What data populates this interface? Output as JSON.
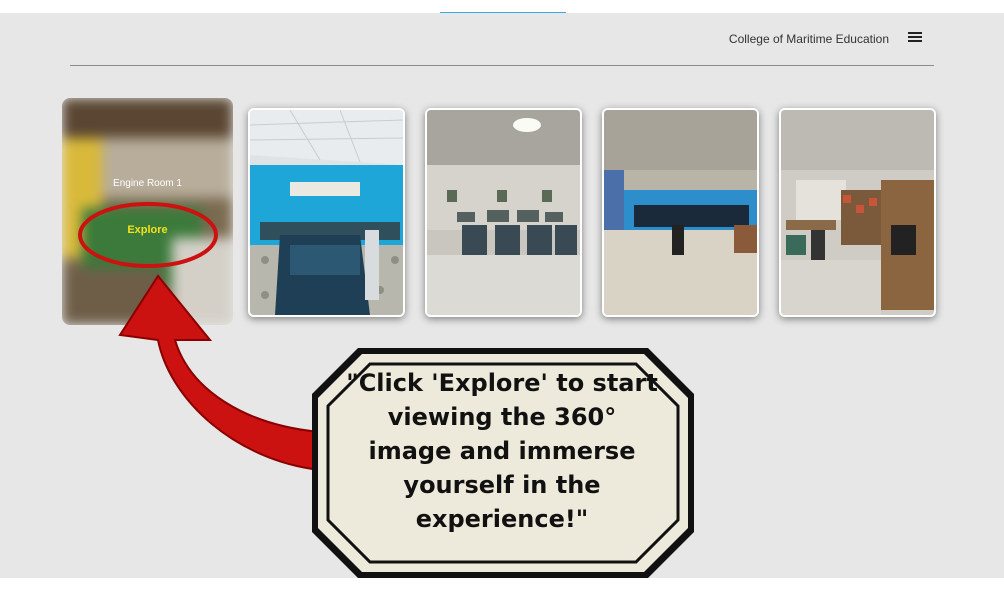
{
  "header": {
    "brand": "College of Maritime Education",
    "menu_icon": "hamburger-icon"
  },
  "featured": {
    "title": "Engine Room 1",
    "explore_label": "Explore"
  },
  "gallery": [
    {
      "name": "engine-room-console"
    },
    {
      "name": "control-room-desks"
    },
    {
      "name": "bridge-simulator"
    },
    {
      "name": "workshop-room"
    }
  ],
  "callout": {
    "lines": [
      "\"Click 'Explore' to start",
      "viewing the 360°",
      "image and immerse",
      "yourself in the",
      "experience!\""
    ]
  },
  "colors": {
    "panel_bg": "#e7e7e7",
    "annotation_red": "#cc1111",
    "explore_yellow": "#f3e21a",
    "callout_fill": "#eeeadb"
  }
}
